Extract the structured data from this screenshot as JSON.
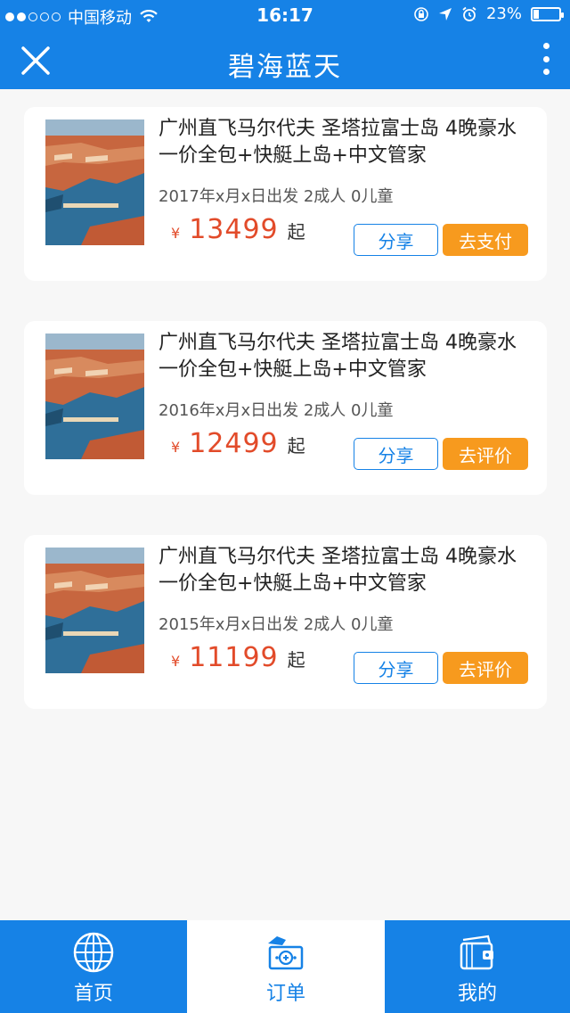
{
  "status_bar": {
    "carrier": "中国移动",
    "time": "16:17",
    "battery": "23%",
    "battery_level": 0.23
  },
  "header": {
    "title": "碧海蓝天"
  },
  "orders": [
    {
      "title": "广州直飞马尔代夫 圣塔拉富士岛 4晚豪水 一价全包+快艇上岛+中文管家",
      "date_info": "2017年x月x日出发 2成人 0儿童",
      "currency": "¥",
      "price": "13499",
      "price_suffix": "起",
      "share_label": "分享",
      "action_label": "去支付"
    },
    {
      "title": "广州直飞马尔代夫 圣塔拉富士岛 4晚豪水 一价全包+快艇上岛+中文管家",
      "date_info": "2016年x月x日出发 2成人 0儿童",
      "currency": "¥",
      "price": "12499",
      "price_suffix": "起",
      "share_label": "分享",
      "action_label": "去评价"
    },
    {
      "title": "广州直飞马尔代夫 圣塔拉富士岛 4晚豪水 一价全包+快艇上岛+中文管家",
      "date_info": "2015年x月x日出发 2成人 0儿童",
      "currency": "¥",
      "price": "11199",
      "price_suffix": "起",
      "share_label": "分享",
      "action_label": "去评价"
    }
  ],
  "tab_bar": {
    "items": [
      {
        "label": "首页",
        "icon": "globe-icon",
        "active": false
      },
      {
        "label": "订单",
        "icon": "order-money-icon",
        "active": true
      },
      {
        "label": "我的",
        "icon": "wallet-icon",
        "active": false
      }
    ]
  },
  "colors": {
    "primary": "#1682e6",
    "accent_orange": "#f79a1e",
    "price_red": "#e24b2a"
  }
}
